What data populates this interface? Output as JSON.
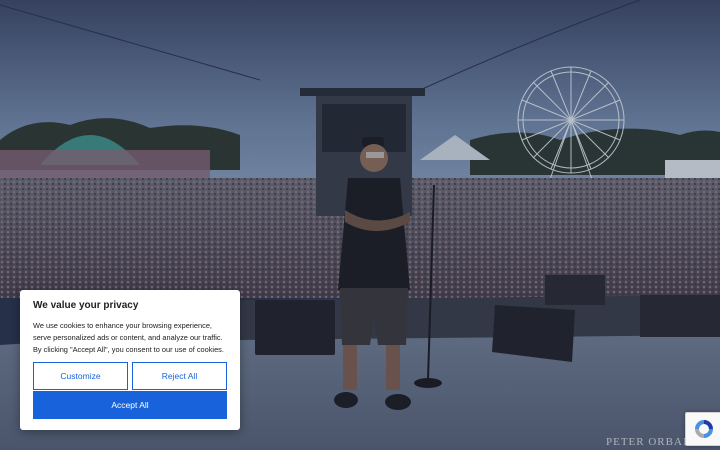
{
  "background": {
    "description_icon": "festival-stage-photo",
    "watermark": "PETER ORBAN"
  },
  "cookie_banner": {
    "title": "We value your privacy",
    "body": "We use cookies to enhance your browsing experience, serve personalized ads or content, and analyze our traffic. By clicking \"Accept All\", you consent to our use of cookies.",
    "customize_label": "Customize",
    "reject_label": "Reject All",
    "accept_label": "Accept All",
    "accent_color": "#1863dc"
  },
  "recaptcha": {
    "icon": "recaptcha-icon"
  }
}
